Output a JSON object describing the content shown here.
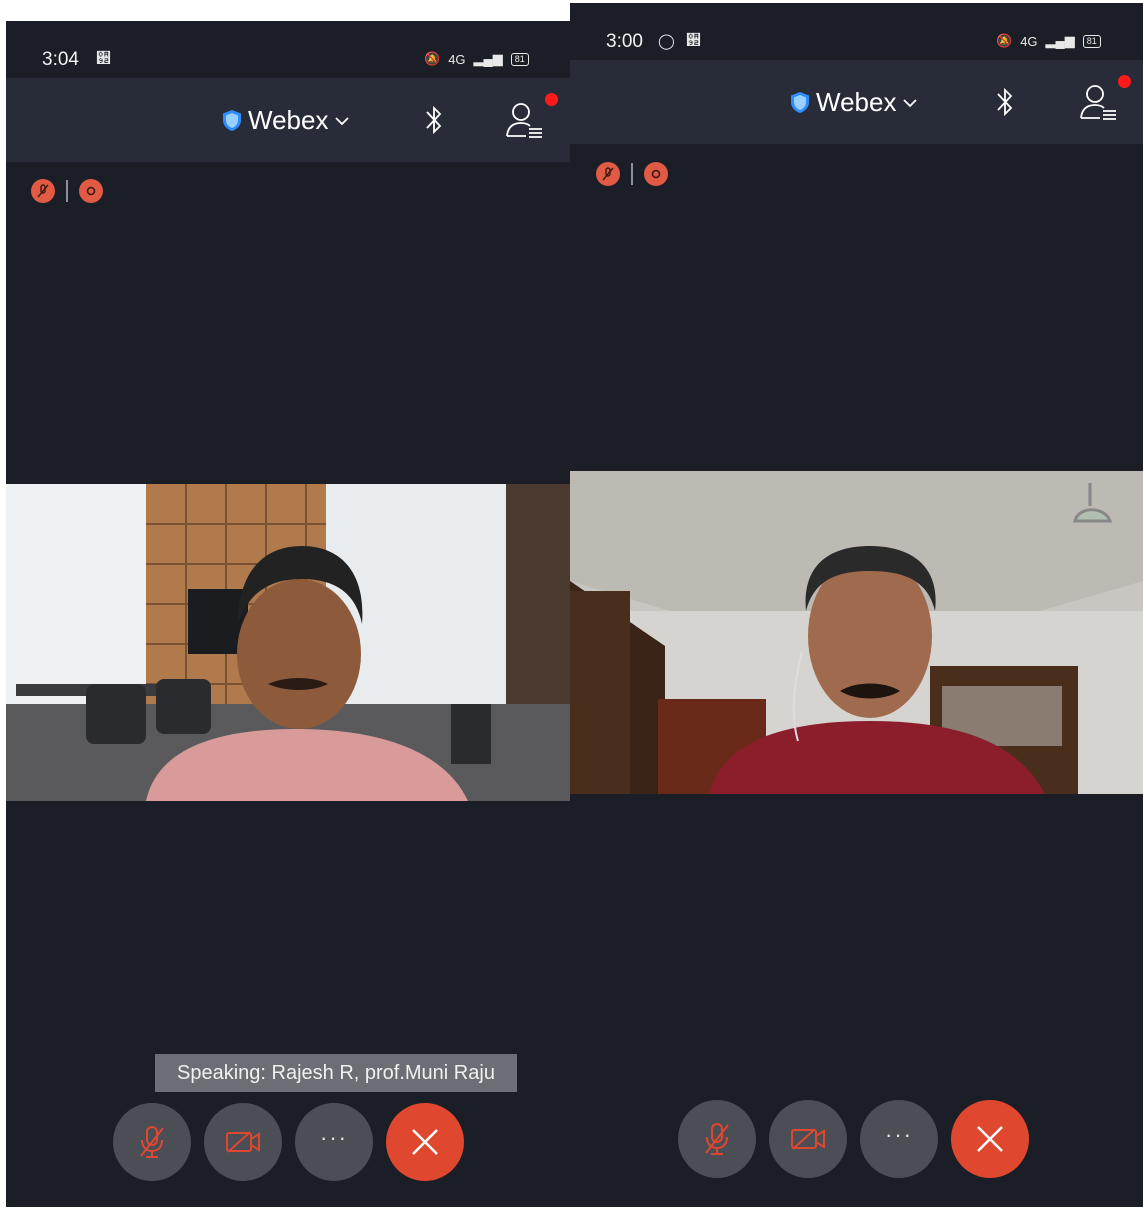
{
  "left_screen": {
    "status": {
      "time": "3:04",
      "left_icon": "઒",
      "network": "4G",
      "battery": "81"
    },
    "app": {
      "brand": "Webex"
    },
    "speaking": "Speaking: Rajesh R, prof.Muni Raju",
    "controls": {
      "more_label": "···"
    }
  },
  "right_screen": {
    "status": {
      "time": "3:00",
      "left_icon": "઒",
      "network": "4G",
      "battery": "81"
    },
    "app": {
      "brand": "Webex"
    },
    "controls": {
      "more_label": "···"
    }
  },
  "colors": {
    "background": "#1b1e26",
    "appbar": "#272c38",
    "end_call": "#e0472f",
    "indicator": "#e05a44",
    "notification_dot": "#ff1a1a"
  },
  "icons": [
    "shield-icon",
    "chevron-down-icon",
    "bluetooth-icon",
    "participants-icon",
    "mute-indicator-icon",
    "recording-indicator-icon",
    "mic-off-icon",
    "video-off-icon",
    "more-icon",
    "close-icon"
  ]
}
